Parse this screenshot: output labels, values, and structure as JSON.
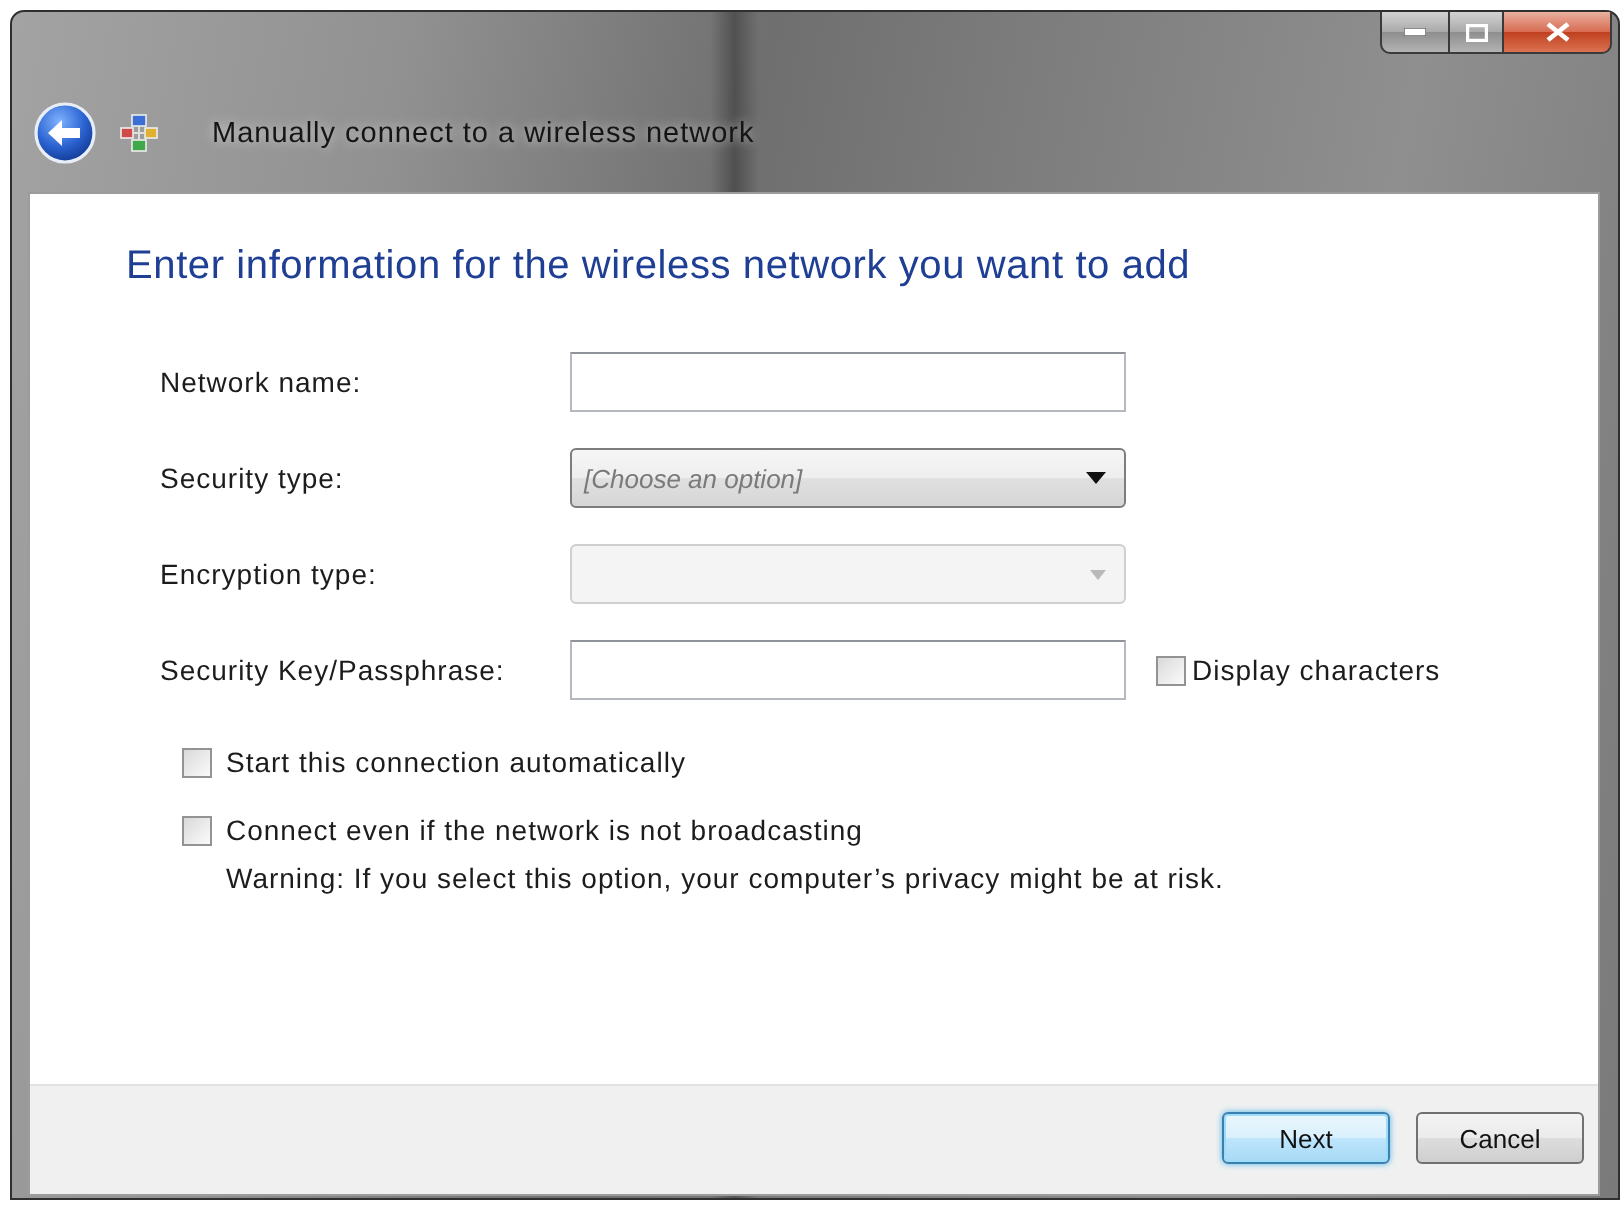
{
  "window": {
    "title": "Manually connect to a wireless network"
  },
  "heading": "Enter information for the wireless network you want to add",
  "fields": [
    {
      "kind": "text",
      "label": "Network name:",
      "disabled": false
    },
    {
      "kind": "dropdown",
      "label": "Security type:",
      "placeholder": "[Choose an option]",
      "disabled": false
    },
    {
      "kind": "dropdown",
      "label": "Encryption type:",
      "disabled": true
    },
    {
      "kind": "text",
      "label": "Security Key/Passphrase:",
      "disabled": false,
      "option": {
        "label": "Display characters",
        "checked": false
      }
    }
  ],
  "options": [
    {
      "label": "Start this connection automatically",
      "checked": false
    },
    {
      "label": "Connect even if the network is not broadcasting",
      "checked": false,
      "note": "Warning: If you select this option, your computer’s privacy might be at risk."
    }
  ],
  "buttons": [
    {
      "label": "Next",
      "default": true
    },
    {
      "label": "Cancel",
      "default": false
    }
  ]
}
